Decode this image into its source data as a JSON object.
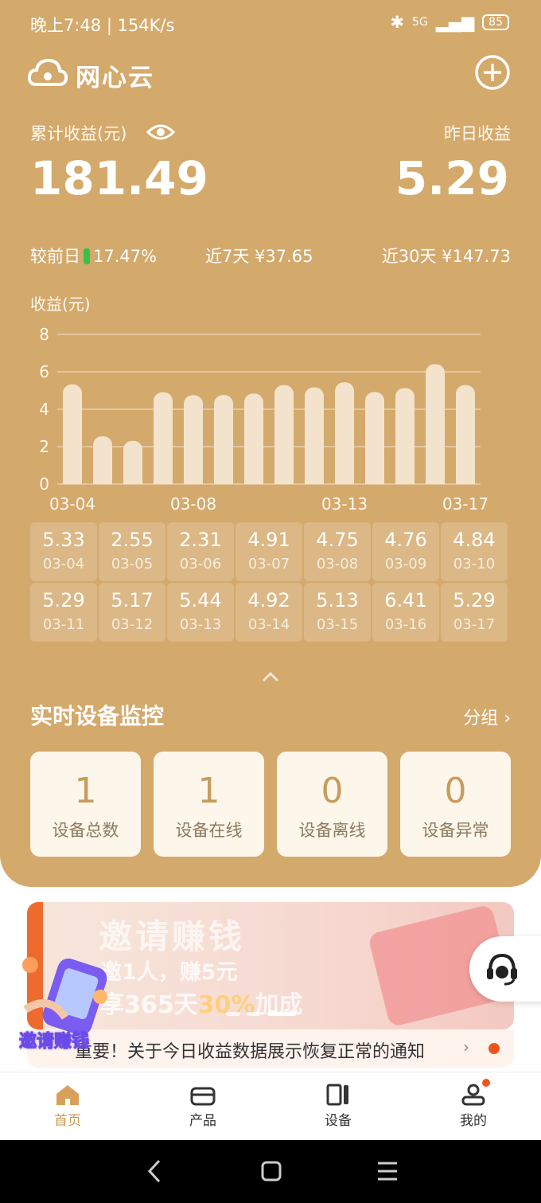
{
  "status_bar": {
    "time": "晚上7:48 | 154K/s",
    "network": "5G",
    "battery": "85"
  },
  "header": {
    "title": "网心云"
  },
  "earnings": {
    "total_label": "累计收益(元)",
    "total_value": "181.49",
    "yesterday_label": "昨日收益",
    "yesterday_value": "5.29",
    "compare_label": "较前日",
    "compare_value": "17.47%",
    "week_label": "近7天 ¥37.65",
    "month_label": "近30天 ¥147.73"
  },
  "chart_data": {
    "type": "bar",
    "title": "",
    "ylabel": "收益(元)",
    "ylim": [
      0,
      8
    ],
    "yticks": [
      "0",
      "2",
      "4",
      "6",
      "8"
    ],
    "xticks": [
      "03-04",
      "03-08",
      "03-13",
      "03-17"
    ],
    "categories": [
      "03-04",
      "03-05",
      "03-06",
      "03-07",
      "03-08",
      "03-09",
      "03-10",
      "03-11",
      "03-12",
      "03-13",
      "03-14",
      "03-15",
      "03-16",
      "03-17"
    ],
    "values": [
      5.33,
      2.55,
      2.31,
      4.91,
      4.75,
      4.76,
      4.84,
      5.29,
      5.17,
      5.44,
      4.92,
      5.13,
      6.41,
      5.29
    ],
    "color": "#f3e3cc"
  },
  "daily_grid": [
    {
      "value": "5.33",
      "date": "03-04"
    },
    {
      "value": "2.55",
      "date": "03-05"
    },
    {
      "value": "2.31",
      "date": "03-06"
    },
    {
      "value": "4.91",
      "date": "03-07"
    },
    {
      "value": "4.75",
      "date": "03-08"
    },
    {
      "value": "4.76",
      "date": "03-09"
    },
    {
      "value": "4.84",
      "date": "03-10"
    },
    {
      "value": "5.29",
      "date": "03-11"
    },
    {
      "value": "5.17",
      "date": "03-12"
    },
    {
      "value": "5.44",
      "date": "03-13"
    },
    {
      "value": "4.92",
      "date": "03-14"
    },
    {
      "value": "5.13",
      "date": "03-15"
    },
    {
      "value": "6.41",
      "date": "03-16"
    },
    {
      "value": "5.29",
      "date": "03-17"
    }
  ],
  "monitor": {
    "title": "实时设备监控",
    "group_link": "分组 ›",
    "cards": [
      {
        "count": "1",
        "label": "设备总数"
      },
      {
        "count": "1",
        "label": "设备在线"
      },
      {
        "count": "0",
        "label": "设备离线"
      },
      {
        "count": "0",
        "label": "设备异常"
      }
    ]
  },
  "banner": {
    "title": "邀请赚钱",
    "line1": "邀1人，赚5元",
    "line2_prefix": "享365天",
    "line2_highlight": "30%",
    "line2_suffix": "加成",
    "badge_text": "邀请赚钱"
  },
  "notice": {
    "text": "重要！关于今日收益数据展示恢复正常的通知",
    "arrow": "›"
  },
  "tabbar": {
    "items": [
      {
        "label": "首页",
        "icon": "home-icon"
      },
      {
        "label": "产品",
        "icon": "box-icon"
      },
      {
        "label": "设备",
        "icon": "device-icon"
      },
      {
        "label": "我的",
        "icon": "user-icon"
      }
    ]
  },
  "colors": {
    "panel": "#d4a96c",
    "accent": "#c89a55",
    "alert": "#f0541e",
    "down": "#35c24a"
  }
}
